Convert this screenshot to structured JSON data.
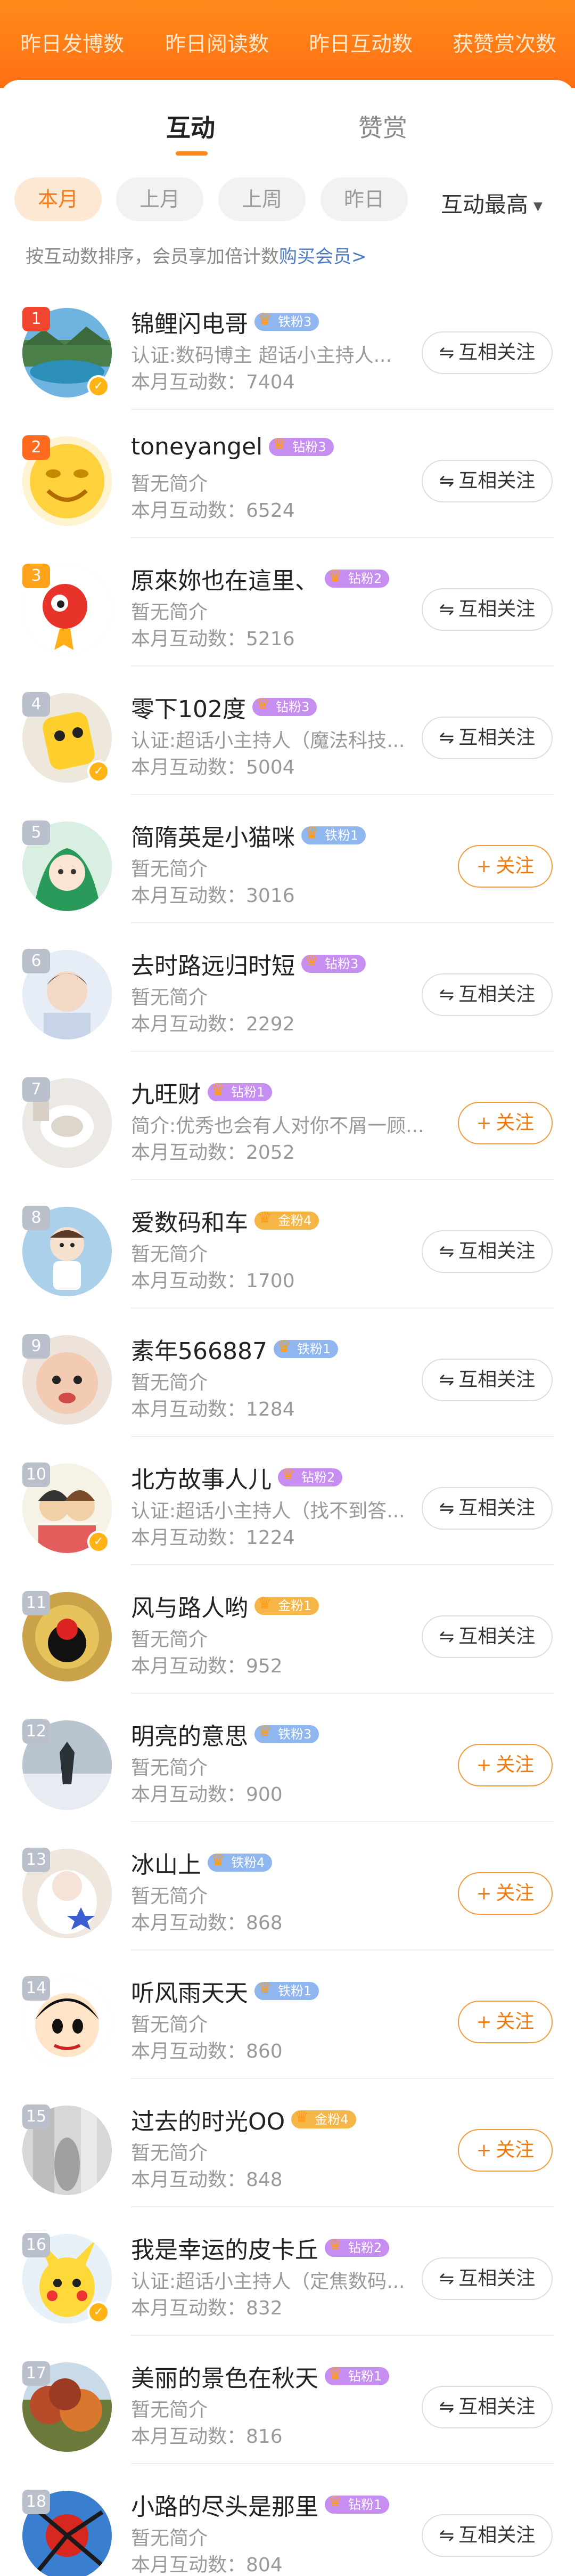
{
  "metrics_bar": [
    "昨日发博数",
    "昨日阅读数",
    "昨日互动数",
    "获赞赏次数"
  ],
  "main_tabs": [
    {
      "label": "互动"
    },
    {
      "label": "赞赏"
    }
  ],
  "period_chips": [
    "本月",
    "上月",
    "上周",
    "昨日"
  ],
  "sort": {
    "label": "互动最高",
    "caret": "▼"
  },
  "hint": {
    "text": "按互动数排序，会员享加倍计数",
    "link": "购买会员>"
  },
  "buttons": {
    "mutual": "互相关注",
    "follow": "关注",
    "mutual_icon": "⇋",
    "follow_icon": "+"
  },
  "colors": {
    "brand": "#ff7a14",
    "link": "#4d7cc7",
    "iron_badge": "#8fb6ee",
    "drill_badge": "#c58ef0",
    "gold_badge": "#f5b547"
  },
  "users": [
    {
      "rank": "1",
      "name": "锦鲤闪电哥",
      "badge": "铁粉3",
      "badge_type": "iron",
      "desc": "认证:数码博主 超话小主持人...",
      "count": "本月互动数：7404",
      "button": "mutual",
      "verified": true
    },
    {
      "rank": "2",
      "name": "toneyangel",
      "badge": "钻粉3",
      "badge_type": "drill",
      "desc": "暂无简介",
      "count": "本月互动数：6524",
      "button": "mutual",
      "verified": false
    },
    {
      "rank": "3",
      "name": "原來妳也在這里、",
      "badge": "钻粉2",
      "badge_type": "drill",
      "desc": "暂无简介",
      "count": "本月互动数：5216",
      "button": "mutual",
      "verified": false
    },
    {
      "rank": "4",
      "name": "零下102度",
      "badge": "钻粉3",
      "badge_type": "drill",
      "desc": "认证:超话小主持人（魔法科技...",
      "count": "本月互动数：5004",
      "button": "mutual",
      "verified": true
    },
    {
      "rank": "5",
      "name": "简隋英是小猫咪",
      "badge": "铁粉1",
      "badge_type": "iron",
      "desc": "暂无简介",
      "count": "本月互动数：3016",
      "button": "follow",
      "verified": false
    },
    {
      "rank": "6",
      "name": "去时路远归时短",
      "badge": "钻粉3",
      "badge_type": "drill",
      "desc": "暂无简介",
      "count": "本月互动数：2292",
      "button": "mutual",
      "verified": false
    },
    {
      "rank": "7",
      "name": "九旺财",
      "badge": "钻粉1",
      "badge_type": "drill",
      "desc": "简介:优秀也会有人对你不屑一顾...",
      "count": "本月互动数：2052",
      "button": "follow",
      "verified": false
    },
    {
      "rank": "8",
      "name": "爱数码和车",
      "badge": "金粉4",
      "badge_type": "gold",
      "desc": "暂无简介",
      "count": "本月互动数：1700",
      "button": "mutual",
      "verified": false
    },
    {
      "rank": "9",
      "name": "素年566887",
      "badge": "铁粉1",
      "badge_type": "iron",
      "desc": "暂无简介",
      "count": "本月互动数：1284",
      "button": "mutual",
      "verified": false
    },
    {
      "rank": "10",
      "name": "北方故事人儿",
      "badge": "钻粉2",
      "badge_type": "drill",
      "desc": "认证:超话小主持人（找不到答...",
      "count": "本月互动数：1224",
      "button": "mutual",
      "verified": true
    },
    {
      "rank": "11",
      "name": "风与路人哟",
      "badge": "金粉1",
      "badge_type": "gold",
      "desc": "暂无简介",
      "count": "本月互动数：952",
      "button": "mutual",
      "verified": false
    },
    {
      "rank": "12",
      "name": "明亮的意思",
      "badge": "铁粉3",
      "badge_type": "iron",
      "desc": "暂无简介",
      "count": "本月互动数：900",
      "button": "follow",
      "verified": false
    },
    {
      "rank": "13",
      "name": "冰山上",
      "badge": "铁粉4",
      "badge_type": "iron",
      "desc": "暂无简介",
      "count": "本月互动数：868",
      "button": "follow",
      "verified": false
    },
    {
      "rank": "14",
      "name": "听风雨天天",
      "badge": "铁粉1",
      "badge_type": "iron",
      "desc": "暂无简介",
      "count": "本月互动数：860",
      "button": "follow",
      "verified": false
    },
    {
      "rank": "15",
      "name": "过去的时光OO",
      "badge": "金粉4",
      "badge_type": "gold",
      "desc": "暂无简介",
      "count": "本月互动数：848",
      "button": "follow",
      "verified": false
    },
    {
      "rank": "16",
      "name": "我是幸运的皮卡丘",
      "badge": "钻粉2",
      "badge_type": "drill",
      "desc": "认证:超话小主持人（定焦数码...",
      "count": "本月互动数：832",
      "button": "mutual",
      "verified": true
    },
    {
      "rank": "17",
      "name": "美丽的景色在秋天",
      "badge": "钻粉1",
      "badge_type": "drill",
      "desc": "暂无简介",
      "count": "本月互动数：816",
      "button": "mutual",
      "verified": false
    },
    {
      "rank": "18",
      "name": "小路的尽头是那里",
      "badge": "钻粉1",
      "badge_type": "drill",
      "desc": "暂无简介",
      "count": "本月互动数：804",
      "button": "mutual",
      "verified": false
    }
  ]
}
